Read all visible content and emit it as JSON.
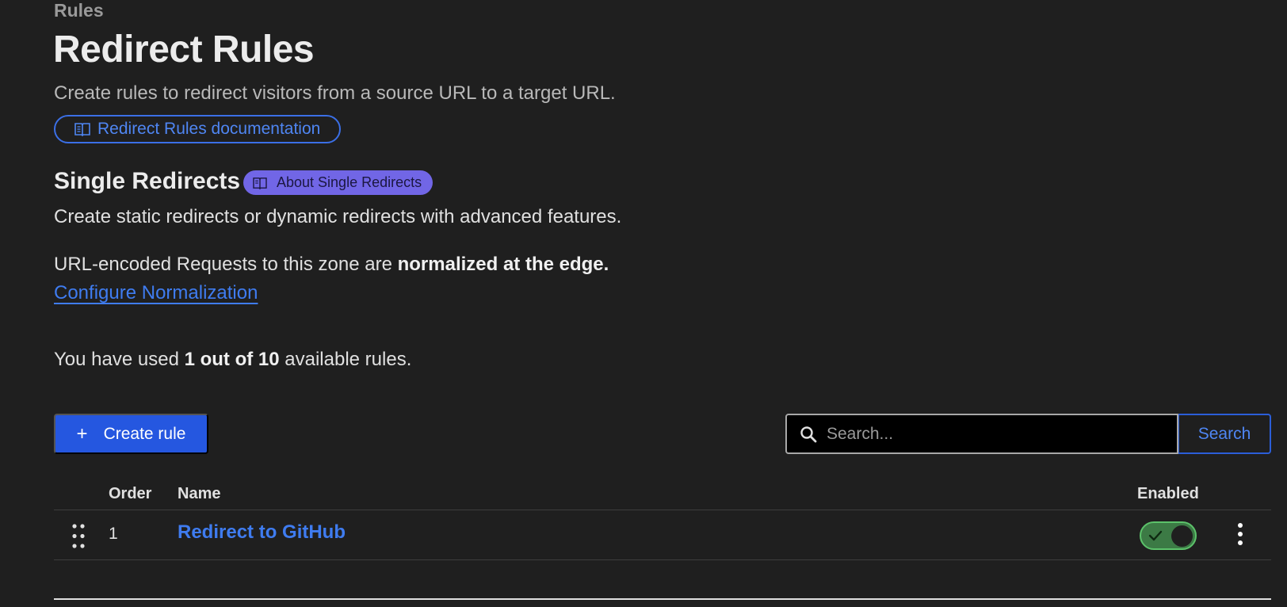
{
  "breadcrumb": "Rules",
  "header": {
    "title": "Redirect Rules",
    "description": "Create rules to redirect visitors from a source URL to a target URL.",
    "doc_link": "Redirect Rules documentation"
  },
  "section": {
    "title": "Single Redirects",
    "badge": "About Single Redirects",
    "description": "Create static redirects or dynamic redirects with advanced features."
  },
  "normalization": {
    "text_prefix": "URL-encoded Requests to this zone are ",
    "text_bold": "normalized at the edge.",
    "link": "Configure Normalization"
  },
  "usage": {
    "prefix": "You have used ",
    "bold": "1 out of 10",
    "suffix": " available rules."
  },
  "toolbar": {
    "create_label": "Create rule",
    "search_placeholder": "Search...",
    "search_value": "",
    "search_button": "Search"
  },
  "table": {
    "columns": {
      "order": "Order",
      "name": "Name",
      "enabled": "Enabled"
    },
    "rows": [
      {
        "order": "1",
        "name": "Redirect to GitHub",
        "enabled": true
      }
    ]
  },
  "colors": {
    "background": "#1f1f1f",
    "accent_blue": "#2557e0",
    "link_blue": "#3f7cf0",
    "badge_purple": "#7166e6",
    "toggle_green": "#3c7a45"
  },
  "icons": [
    "book-icon",
    "plus-icon",
    "search-icon",
    "drag-handle-icon",
    "check-icon",
    "kebab-menu-icon"
  ]
}
